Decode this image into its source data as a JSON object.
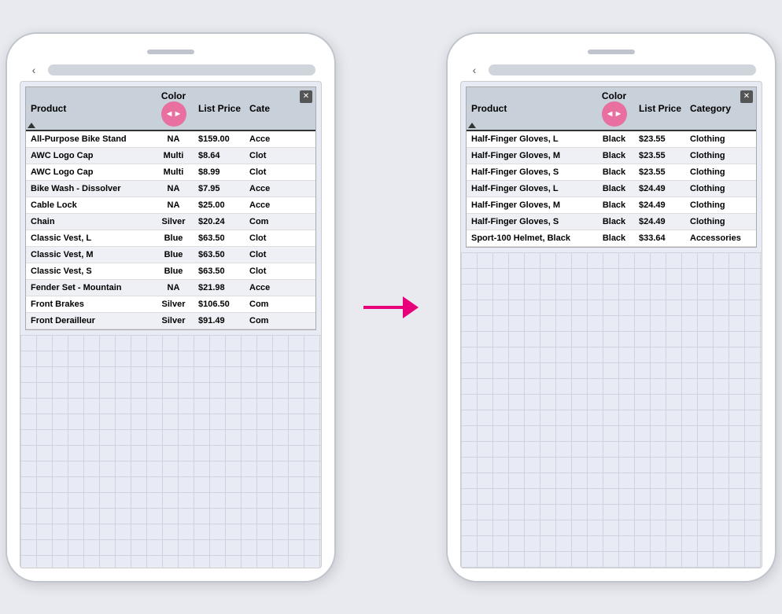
{
  "left_phone": {
    "speaker": "",
    "back_label": "‹",
    "table": {
      "headers": [
        "Product",
        "Color",
        "List Price",
        "Cate"
      ],
      "resize_icon": "◄►",
      "close_icon": "✕",
      "rows": [
        {
          "product": "All-Purpose Bike Stand",
          "color": "NA",
          "price": "$159.00",
          "category": "Acce",
          "alt": false
        },
        {
          "product": "AWC Logo Cap",
          "color": "Multi",
          "price": "$8.64",
          "category": "Clot",
          "alt": true
        },
        {
          "product": "AWC Logo Cap",
          "color": "Multi",
          "price": "$8.99",
          "category": "Clot",
          "alt": false
        },
        {
          "product": "Bike Wash - Dissolver",
          "color": "NA",
          "price": "$7.95",
          "category": "Acce",
          "alt": true
        },
        {
          "product": "Cable Lock",
          "color": "NA",
          "price": "$25.00",
          "category": "Acce",
          "alt": false
        },
        {
          "product": "Chain",
          "color": "Silver",
          "price": "$20.24",
          "category": "Com",
          "alt": true
        },
        {
          "product": "Classic Vest, L",
          "color": "Blue",
          "price": "$63.50",
          "category": "Clot",
          "alt": false
        },
        {
          "product": "Classic Vest, M",
          "color": "Blue",
          "price": "$63.50",
          "category": "Clot",
          "alt": true
        },
        {
          "product": "Classic Vest, S",
          "color": "Blue",
          "price": "$63.50",
          "category": "Clot",
          "alt": false
        },
        {
          "product": "Fender Set - Mountain",
          "color": "NA",
          "price": "$21.98",
          "category": "Acce",
          "alt": true
        },
        {
          "product": "Front Brakes",
          "color": "Silver",
          "price": "$106.50",
          "category": "Com",
          "alt": false
        },
        {
          "product": "Front Derailleur",
          "color": "Silver",
          "price": "$91.49",
          "category": "Com",
          "alt": true
        }
      ]
    }
  },
  "right_phone": {
    "speaker": "",
    "back_label": "‹",
    "table": {
      "headers": [
        "Product",
        "Color",
        "List Price",
        "Category"
      ],
      "resize_icon": "◄►",
      "close_icon": "✕",
      "rows": [
        {
          "product": "Half-Finger Gloves, L",
          "color": "Black",
          "price": "$23.55",
          "category": "Clothing",
          "alt": false
        },
        {
          "product": "Half-Finger Gloves, M",
          "color": "Black",
          "price": "$23.55",
          "category": "Clothing",
          "alt": true
        },
        {
          "product": "Half-Finger Gloves, S",
          "color": "Black",
          "price": "$23.55",
          "category": "Clothing",
          "alt": false
        },
        {
          "product": "Half-Finger Gloves, L",
          "color": "Black",
          "price": "$24.49",
          "category": "Clothing",
          "alt": true
        },
        {
          "product": "Half-Finger Gloves, M",
          "color": "Black",
          "price": "$24.49",
          "category": "Clothing",
          "alt": false
        },
        {
          "product": "Half-Finger Gloves, S",
          "color": "Black",
          "price": "$24.49",
          "category": "Clothing",
          "alt": true
        },
        {
          "product": "Sport-100 Helmet, Black",
          "color": "Black",
          "price": "$33.64",
          "category": "Accessories",
          "alt": false
        }
      ]
    }
  },
  "arrow": {
    "label": "→"
  }
}
